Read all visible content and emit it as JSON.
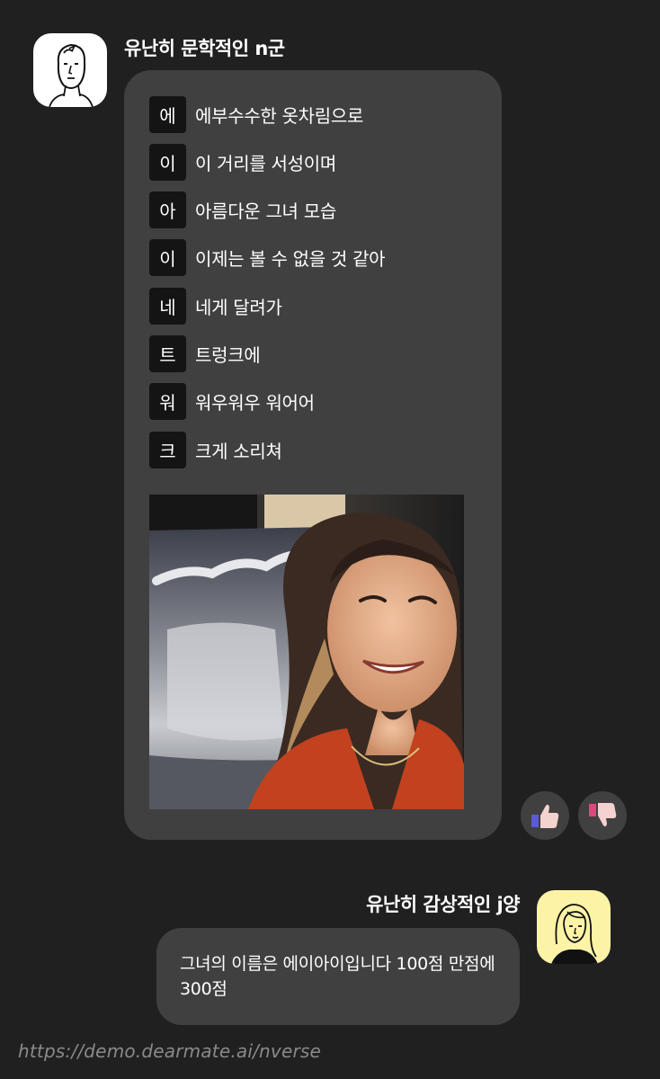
{
  "bot": {
    "name": "유난히 문학적인 n군",
    "avatar_icon": "man-sketch-avatar",
    "acrostic": [
      {
        "key": "에",
        "line": "에부수수한 옷차림으로"
      },
      {
        "key": "이",
        "line": "이 거리를 서성이며"
      },
      {
        "key": "아",
        "line": "아름다운 그녀 모습"
      },
      {
        "key": "이",
        "line": "이제는 볼 수 없을 것 같아"
      },
      {
        "key": "네",
        "line": "네게 달려가"
      },
      {
        "key": "트",
        "line": "트렁크에"
      },
      {
        "key": "워",
        "line": "워우워우 워어어"
      },
      {
        "key": "크",
        "line": "크게 소리쳐"
      }
    ],
    "photo_alt": "smiling woman selfie in front of a painting"
  },
  "reactions": {
    "like_icon": "thumbs-up-icon",
    "dislike_icon": "thumbs-down-icon"
  },
  "user": {
    "name": "유난히 감상적인 j양",
    "avatar_icon": "woman-sketch-avatar",
    "message": "그녀의 이름은 에이아이입니다 100점 만점에 300점"
  },
  "watermark": "https://demo.dearmate.ai/nverse",
  "colors": {
    "background": "#202020",
    "bubble": "#404040",
    "key_box": "#141414",
    "user_avatar_bg": "#fdf3a6",
    "like_accent": "#5b5bd6",
    "dislike_accent": "#e0457b"
  }
}
